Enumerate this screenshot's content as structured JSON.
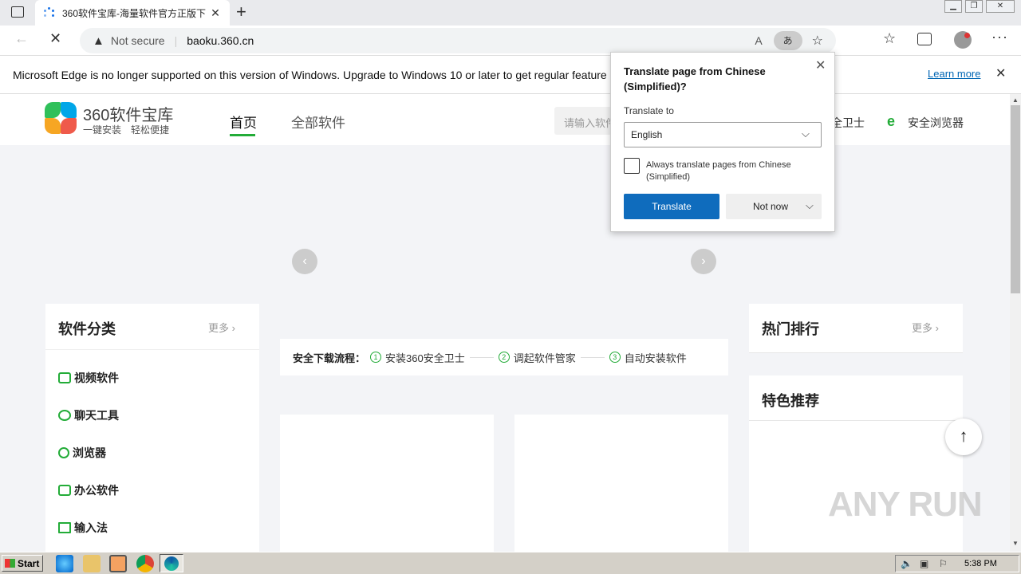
{
  "browser": {
    "tab_title": "360软件宝库-海量软件官方正版下",
    "security_label": "Not secure",
    "url": "baoku.360.cn",
    "read_aloud_icon": "A",
    "translate_icon": "あ"
  },
  "notification": {
    "message": "Microsoft Edge is no longer supported on this version of Windows. Upgrade to Windows 10 or later to get regular feature and",
    "learn_more": "Learn more"
  },
  "site": {
    "logo_title": "360软件宝库",
    "logo_subtitle": "一键安装　轻松便捷",
    "nav": [
      "首页",
      "全部软件"
    ],
    "search_placeholder": "请输入软件",
    "right_links": [
      "全卫士",
      "安全浏览器"
    ]
  },
  "categories": {
    "title": "软件分类",
    "more": "更多",
    "items": [
      "视频软件",
      "聊天工具",
      "浏览器",
      "办公软件",
      "输入法"
    ]
  },
  "download_steps": {
    "label": "安全下载流程：",
    "steps": [
      {
        "num": "1",
        "text": "安装360安全卫士"
      },
      {
        "num": "2",
        "text": "调起软件管家"
      },
      {
        "num": "3",
        "text": "自动安装软件"
      }
    ]
  },
  "hot_ranking": {
    "title": "热门排行",
    "more": "更多"
  },
  "featured": {
    "title": "特色推荐"
  },
  "translate_popup": {
    "title": "Translate page from Chinese (Simplified)?",
    "translate_to_label": "Translate to",
    "language": "English",
    "always_label": "Always translate pages from Chinese (Simplified)",
    "translate_button": "Translate",
    "not_now_button": "Not now"
  },
  "taskbar": {
    "start": "Start",
    "time": "5:38 PM"
  },
  "watermark": "ANY RUN",
  "colors": {
    "accent_green": "#23ac38",
    "edge_blue": "#0f6cbd",
    "link_blue": "#0066b4"
  }
}
